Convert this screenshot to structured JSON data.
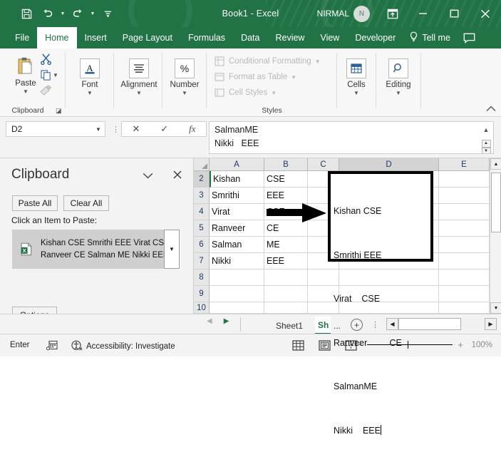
{
  "titlebar": {
    "quick_access": [
      {
        "name": "save-icon",
        "label": "Save"
      },
      {
        "name": "undo-icon",
        "label": "Undo"
      },
      {
        "name": "redo-icon",
        "label": "Redo"
      },
      {
        "name": "customize-qat-icon",
        "label": "Customize Quick Access Toolbar"
      }
    ],
    "document_title": "Book1  -  Excel",
    "account_name": "NIRMAL",
    "account_initial": "N",
    "ribbon_display_label": "Ribbon Display Options",
    "minimize_label": "–",
    "restore_label": "□",
    "close_label": "✕"
  },
  "ribbon_tabs": [
    {
      "label": "File",
      "active": false
    },
    {
      "label": "Home",
      "active": true
    },
    {
      "label": "Insert",
      "active": false
    },
    {
      "label": "Page Layout",
      "active": false
    },
    {
      "label": "Formulas",
      "active": false
    },
    {
      "label": "Data",
      "active": false
    },
    {
      "label": "Review",
      "active": false
    },
    {
      "label": "View",
      "active": false
    },
    {
      "label": "Developer",
      "active": false
    }
  ],
  "tell_me": "Tell me",
  "ribbon": {
    "clipboard": {
      "group_label": "Clipboard",
      "paste_label": "Paste",
      "cut_label": "Cut",
      "copy_label": "Copy",
      "format_painter_label": "Format Painter"
    },
    "font": {
      "label": "Font"
    },
    "alignment": {
      "label": "Alignment"
    },
    "number": {
      "label": "Number",
      "glyph": "%"
    },
    "styles": {
      "group_label": "Styles",
      "items": [
        "Conditional Formatting",
        "Format as Table",
        "Cell Styles"
      ]
    },
    "cells": {
      "label": "Cells"
    },
    "editing": {
      "label": "Editing"
    }
  },
  "formula_bar": {
    "name_box_value": "D2",
    "cancel_label": "✕",
    "enter_label": "✓",
    "insert_function_label": "fx",
    "content_line1": "SalmanME",
    "content_line2": "Nikki   EEE"
  },
  "clipboard_pane": {
    "title": "Clipboard",
    "collapse_label": "⌄",
    "close_label": "✕",
    "paste_all_label": "Paste All",
    "clear_all_label": "Clear All",
    "hint": "Click an Item to Paste:",
    "items": [
      {
        "icon": "excel-file-icon",
        "line1": "Kishan CSE Smrithi EEE Virat CSE",
        "line2": "Ranveer CE Salman ME Nikki EEE"
      }
    ],
    "options_label": "Options"
  },
  "grid": {
    "columns": [
      {
        "label": "A",
        "selected": false
      },
      {
        "label": "B",
        "selected": false
      },
      {
        "label": "C",
        "selected": false
      },
      {
        "label": "D",
        "selected": true
      },
      {
        "label": "E",
        "selected": false
      }
    ],
    "rows": [
      {
        "label": "2",
        "selected": true,
        "a": "Kishan",
        "b": "CSE",
        "c": "",
        "e": ""
      },
      {
        "label": "3",
        "selected": false,
        "a": "Smrithi",
        "b": "EEE",
        "c": "",
        "e": ""
      },
      {
        "label": "4",
        "selected": false,
        "a": "Virat",
        "b": "CSE",
        "c": "",
        "e": ""
      },
      {
        "label": "5",
        "selected": false,
        "a": "Ranveer",
        "b": "CE",
        "c": "",
        "e": ""
      },
      {
        "label": "6",
        "selected": false,
        "a": "Salman",
        "b": "ME",
        "c": "",
        "e": ""
      },
      {
        "label": "7",
        "selected": false,
        "a": "Nikki",
        "b": "EEE",
        "c": "",
        "e": ""
      },
      {
        "label": "8",
        "selected": false,
        "a": "",
        "b": "",
        "c": "",
        "e": ""
      },
      {
        "label": "9",
        "selected": false,
        "a": "",
        "b": "",
        "c": "",
        "e": ""
      },
      {
        "label": "10",
        "selected": false,
        "a": "",
        "b": "",
        "c": "",
        "e": ""
      }
    ],
    "edit_cell": {
      "reference": "D2",
      "lines": [
        "Kishan CSE",
        "Smrithi EEE",
        "Virat    CSE",
        "Ranveer         CE",
        "SalmanME",
        "Nikki    EEE"
      ]
    },
    "annotation": {
      "name": "black-arrow-annotation"
    }
  },
  "sheet_bar": {
    "first_label": "◀",
    "prev_label": "◀",
    "next_label": "▶",
    "tabs": [
      {
        "label": "Sheet1",
        "active": false
      },
      {
        "label": "Sh",
        "active": true
      }
    ],
    "overflow_label": "...",
    "add_sheet_label": "+",
    "more_label": "⋮"
  },
  "status_bar": {
    "mode": "Enter",
    "macro_label": "Record Macro",
    "accessibility": "Accessibility: Investigate",
    "views": [
      {
        "name": "normal-view-icon",
        "label": "Normal"
      },
      {
        "name": "page-layout-view-icon",
        "label": "Page Layout"
      },
      {
        "name": "page-break-view-icon",
        "label": "Page Break Preview"
      }
    ],
    "zoom_out_label": "−",
    "zoom_in_label": "+",
    "zoom_level": "100%"
  },
  "colors": {
    "brand_green": "#217346",
    "ribbon_bg": "#f7f7f7",
    "grid_line": "#d4d4d4",
    "header_bg": "#e6e6e6",
    "selection_gray": "#cfcfcf",
    "header_text": "#1f3864"
  }
}
